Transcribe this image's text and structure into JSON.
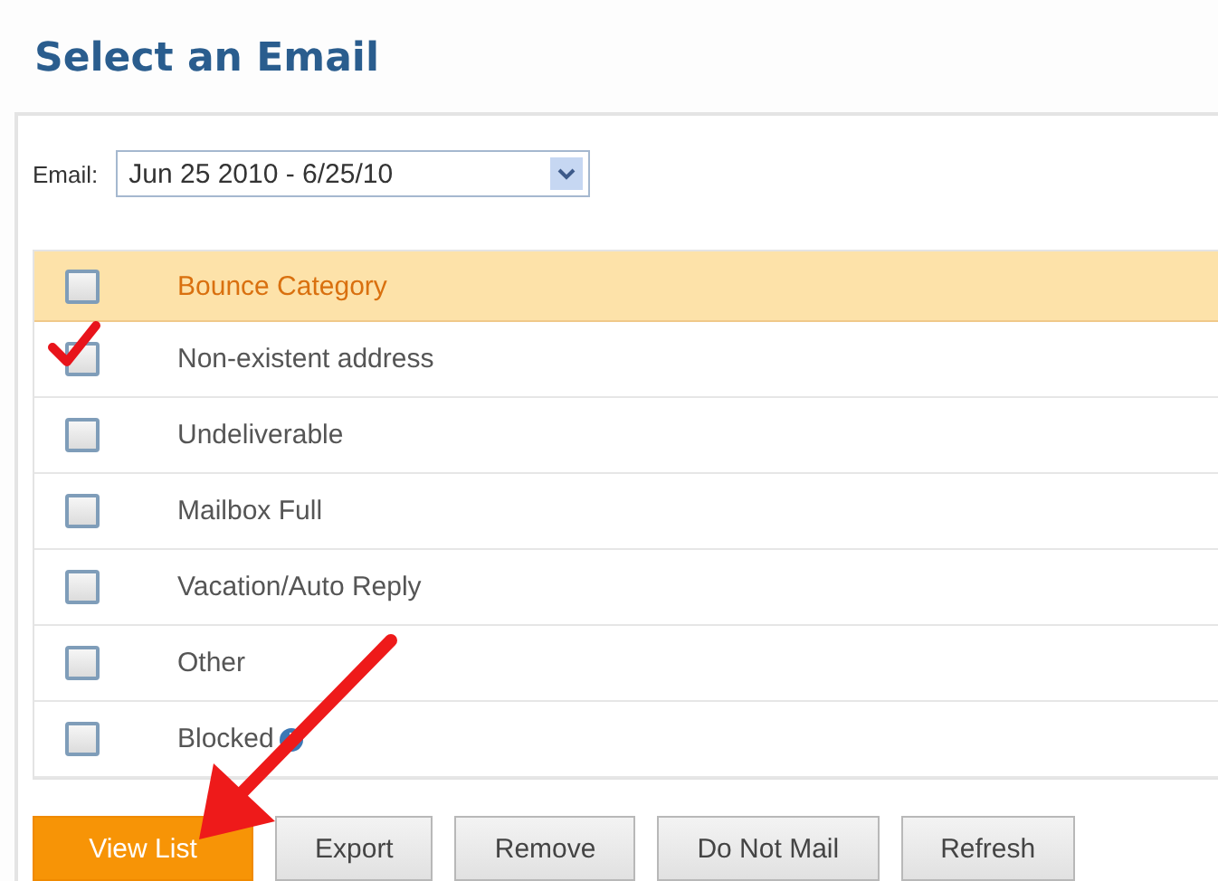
{
  "title": "Select an Email",
  "email": {
    "label": "Email:",
    "value": "Jun 25 2010 - 6/25/10"
  },
  "table": {
    "header": {
      "label": "Bounce Category",
      "checked": false
    },
    "rows": [
      {
        "label": "Non-existent address",
        "checked": true,
        "info": false
      },
      {
        "label": "Undeliverable",
        "checked": false,
        "info": false
      },
      {
        "label": "Mailbox Full",
        "checked": false,
        "info": false
      },
      {
        "label": "Vacation/Auto Reply",
        "checked": false,
        "info": false
      },
      {
        "label": "Other",
        "checked": false,
        "info": false
      },
      {
        "label": "Blocked",
        "checked": false,
        "info": true
      }
    ]
  },
  "buttons": [
    {
      "label": "View List",
      "kind": "primary"
    },
    {
      "label": "Export",
      "kind": "secondary"
    },
    {
      "label": "Remove",
      "kind": "secondary"
    },
    {
      "label": "Do Not Mail",
      "kind": "secondary"
    },
    {
      "label": "Refresh",
      "kind": "secondary"
    }
  ]
}
